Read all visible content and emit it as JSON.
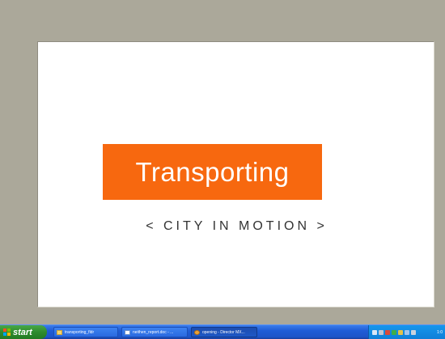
{
  "slide": {
    "title": "Transporting",
    "subtitle": "< CITY IN MOTION >",
    "title_bg": "#f7680f",
    "stage_bg": "#ffffff",
    "surround_bg": "#aba89a"
  },
  "taskbar": {
    "start_label": "start",
    "tasks": [
      {
        "label": "transporting_fldr",
        "icon": "folder-icon"
      },
      {
        "label": "neithen_report.doc - ...",
        "icon": "word-doc-icon"
      },
      {
        "label": "opening - Director MX...",
        "icon": "director-icon"
      }
    ],
    "tray_icons": [
      "network-icon",
      "speaker-icon",
      "shield-icon",
      "messenger-icon",
      "antivirus-icon",
      "update-icon",
      "usb-icon"
    ],
    "clock": "1:0"
  }
}
